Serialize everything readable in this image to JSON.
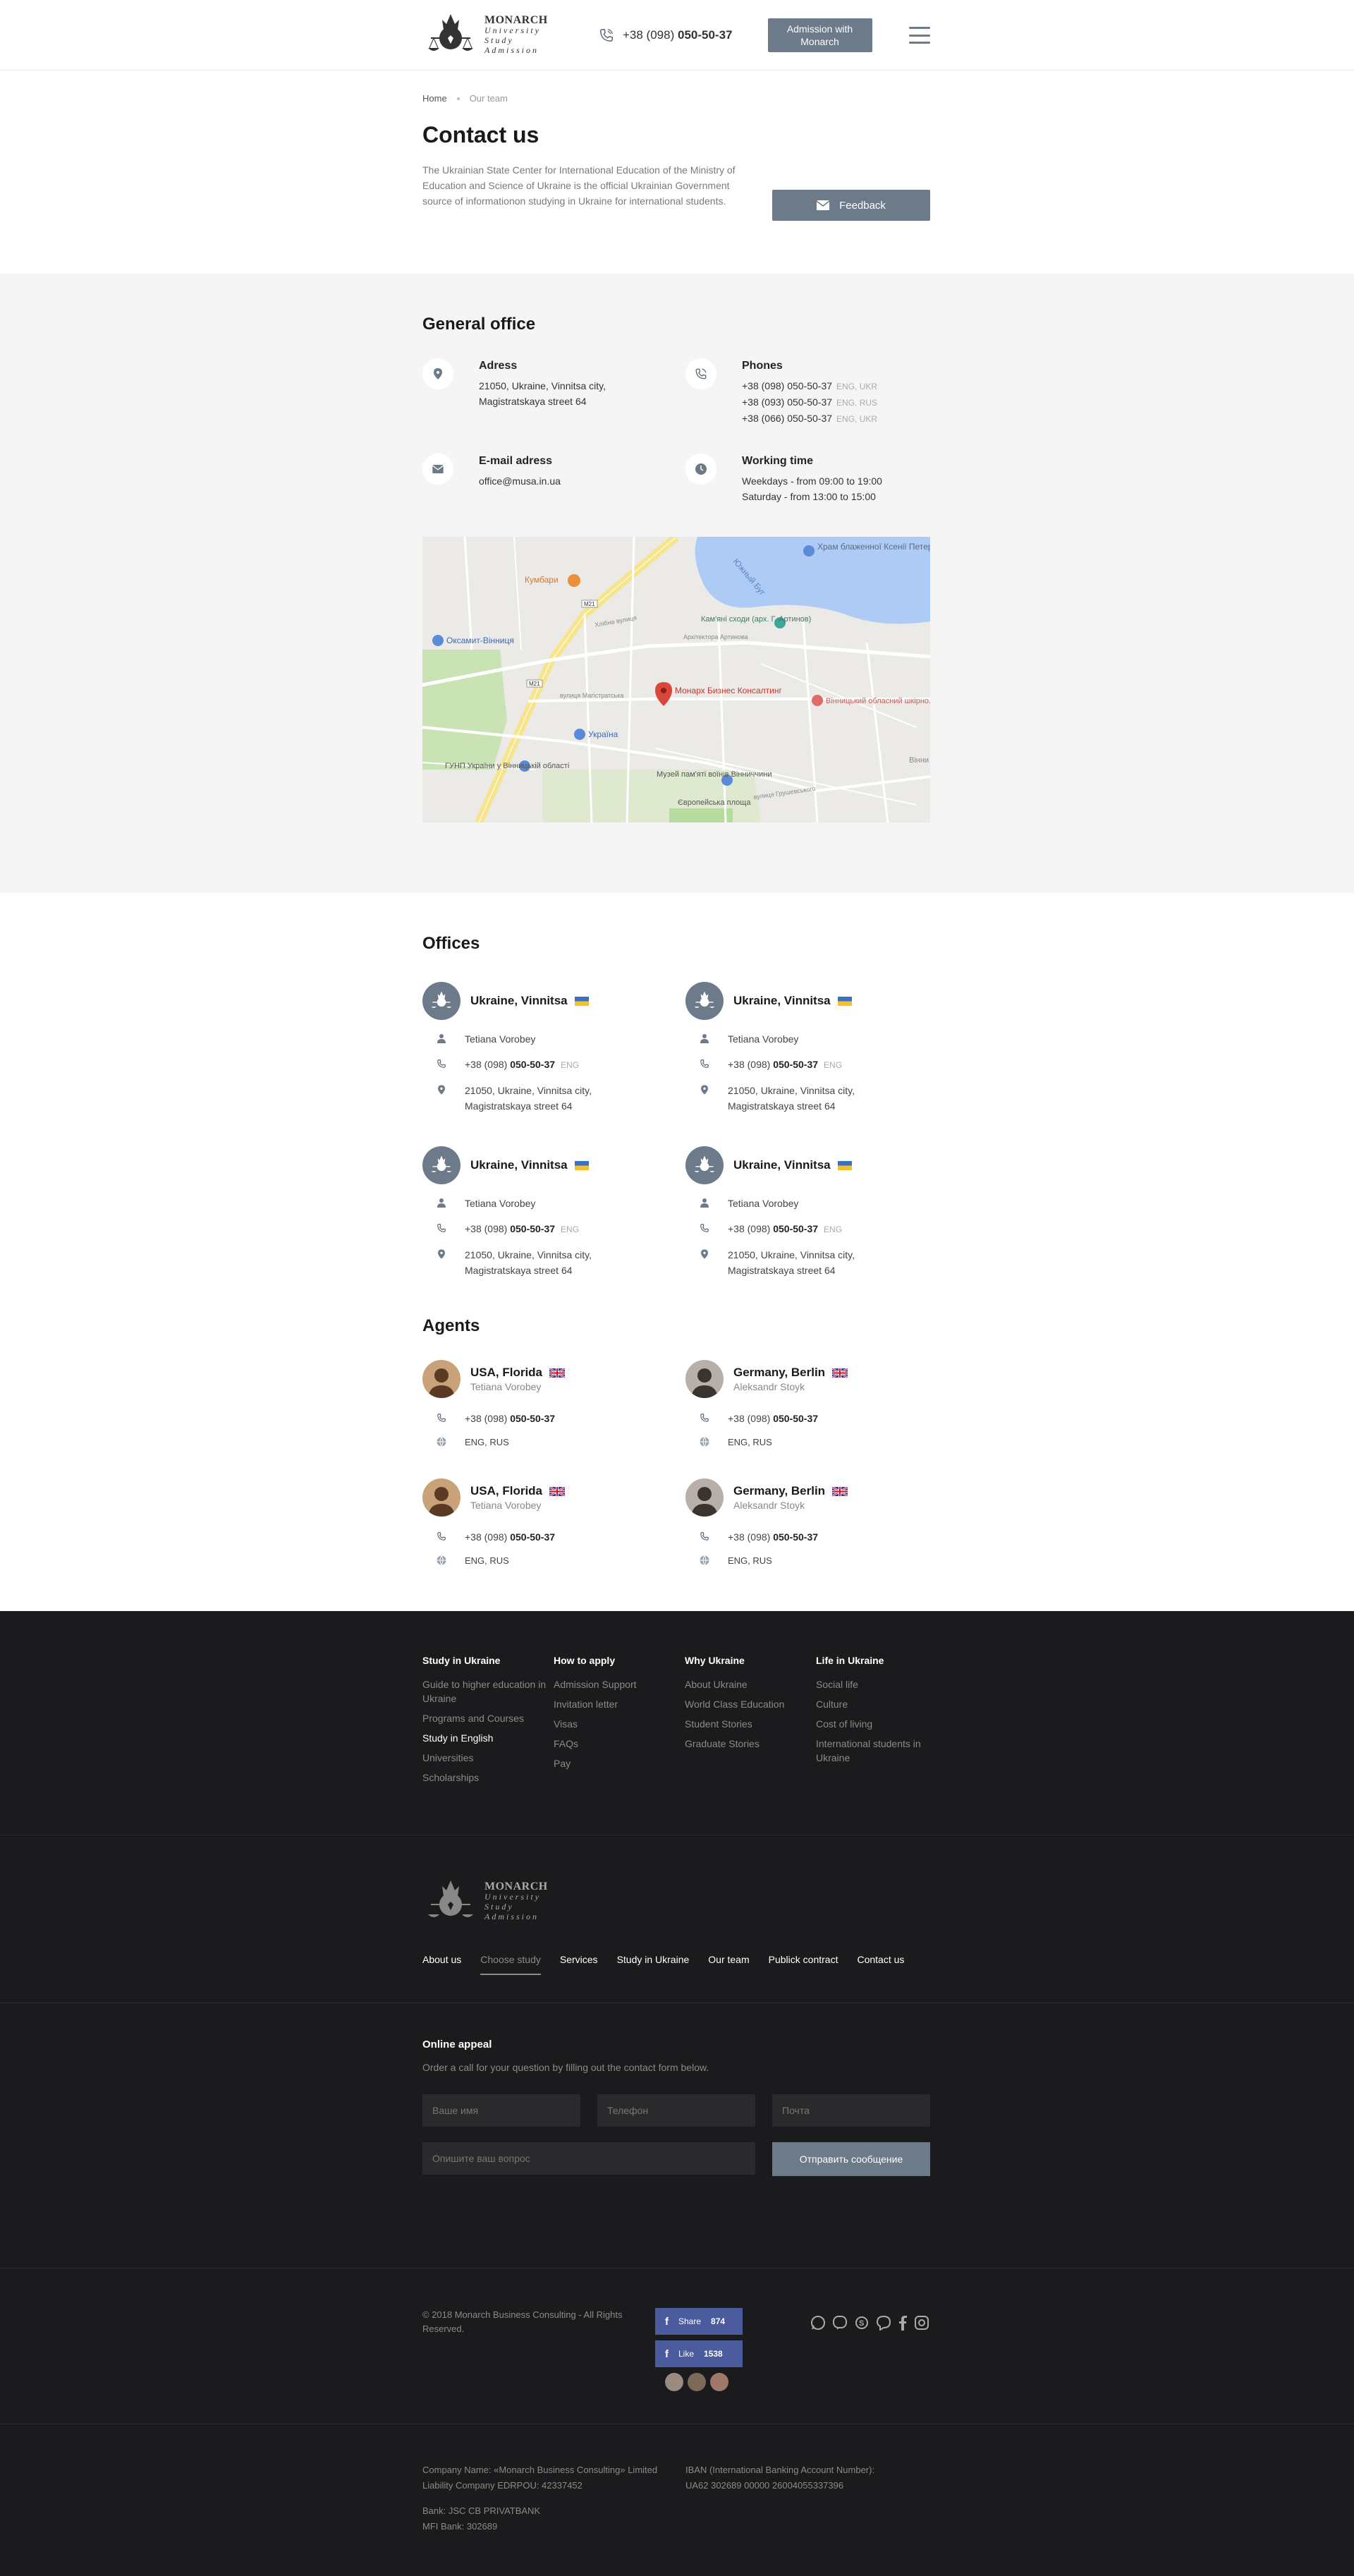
{
  "header": {
    "logo": {
      "title": "MONARCH",
      "l1": "University",
      "l2": "Study",
      "l3": "Admission"
    },
    "phone_prefix": "+38 (098)",
    "phone_main": "050-50-37",
    "admission_button": "Admission with Monarch"
  },
  "intro": {
    "breadcrumbs": [
      "Home",
      "Our team"
    ],
    "title": "Contact us",
    "description": "The Ukrainian State Center for International Education of the Ministry of Education and Science of Ukraine is the official Ukrainian Government source of informationon studying in Ukraine for international students.",
    "feedback_button": "Feedback"
  },
  "general": {
    "title": "General office",
    "address": {
      "label": "Adress",
      "lines": [
        "21050, Ukraine, Vinnitsa city,",
        "Magistratskaya street 64"
      ]
    },
    "phones": {
      "label": "Phones",
      "items": [
        {
          "num": "+38 (098) 050-50-37",
          "lang": "ENG, UKR"
        },
        {
          "num": "+38 (093) 050-50-37",
          "lang": "ENG, RUS"
        },
        {
          "num": "+38 (066) 050-50-37",
          "lang": "ENG, UKR"
        }
      ]
    },
    "email": {
      "label": "E-mail adress",
      "value": "office@musa.in.ua"
    },
    "working": {
      "label": "Working time",
      "lines": [
        "Weekdays - from 09:00 to 19:00",
        "Saturday - from 13:00 to 15:00"
      ]
    }
  },
  "map": {
    "labels": {
      "church": "Храм блаженної Ксенії Петербурзької",
      "kumbari": "Кумбари",
      "river": "Южный Буг",
      "stairs": "Кам'яні сходи (арх. Г. Артинов)",
      "oksamyt": "Оксамит-Вінниця",
      "marker": "Монарх Бизнес Консалтинг",
      "hospital": "Вінницький обласний шкірно...",
      "ukraine": "Україна",
      "gunp": "ГУНП України у Вінницькій області",
      "museum": "Музей пам'яті воїнів Вінниччини",
      "square": "Європейська площа",
      "vinn": "Вінни",
      "road1": "М21",
      "road2": "М21",
      "street1": "Хлібна вулиця",
      "street2": "Архітектора Артинова",
      "street3": "вулиця Магістратська",
      "street4": "вулиця Грушевського"
    }
  },
  "offices": {
    "title": "Offices",
    "items": [
      {
        "city": "Ukraine, Vinnitsa",
        "person": "Tetiana Vorobey",
        "phone_prefix": "+38 (098)",
        "phone_main": "050-50-37",
        "lang": "ENG",
        "addr1": "21050, Ukraine, Vinnitsa city,",
        "addr2": "Magistratskaya street 64"
      },
      {
        "city": "Ukraine, Vinnitsa",
        "person": "Tetiana Vorobey",
        "phone_prefix": "+38 (098)",
        "phone_main": "050-50-37",
        "lang": "ENG",
        "addr1": "21050, Ukraine, Vinnitsa city,",
        "addr2": "Magistratskaya street 64"
      },
      {
        "city": "Ukraine, Vinnitsa",
        "person": "Tetiana Vorobey",
        "phone_prefix": "+38 (098)",
        "phone_main": "050-50-37",
        "lang": "ENG",
        "addr1": "21050, Ukraine, Vinnitsa city,",
        "addr2": "Magistratskaya street 64"
      },
      {
        "city": "Ukraine, Vinnitsa",
        "person": "Tetiana Vorobey",
        "phone_prefix": "+38 (098)",
        "phone_main": "050-50-37",
        "lang": "ENG",
        "addr1": "21050, Ukraine, Vinnitsa city,",
        "addr2": "Magistratskaya street 64"
      }
    ]
  },
  "agents": {
    "title": "Agents",
    "items": [
      {
        "city": "USA, Florida",
        "name": "Tetiana Vorobey",
        "phone_prefix": "+38 (098)",
        "phone_main": "050-50-37",
        "langs": "ENG, RUS"
      },
      {
        "city": "Germany, Berlin",
        "name": "Aleksandr Stoyk",
        "phone_prefix": "+38 (098)",
        "phone_main": "050-50-37",
        "langs": "ENG, RUS"
      },
      {
        "city": "USA, Florida",
        "name": "Tetiana Vorobey",
        "phone_prefix": "+38 (098)",
        "phone_main": "050-50-37",
        "langs": "ENG, RUS"
      },
      {
        "city": "Germany, Berlin",
        "name": "Aleksandr Stoyk",
        "phone_prefix": "+38 (098)",
        "phone_main": "050-50-37",
        "langs": "ENG, RUS"
      }
    ]
  },
  "footer": {
    "columns": [
      {
        "title": "Study in Ukraine",
        "links": [
          "Guide to higher education in Ukraine",
          "Programs and Courses",
          "Study in English",
          "Universities",
          "Scholarships"
        ]
      },
      {
        "title": "How to apply",
        "links": [
          "Admission Support",
          "Invitation letter",
          "Visas",
          "FAQs",
          "Pay"
        ]
      },
      {
        "title": "Why Ukraine",
        "links": [
          "About Ukraine",
          "World Class Education",
          "Student Stories",
          "Graduate Stories"
        ]
      },
      {
        "title": "Life in Ukraine",
        "links": [
          "Social life",
          "Culture",
          "Cost of living",
          "International students in Ukraine"
        ]
      }
    ],
    "menu": [
      "About us",
      "Choose study",
      "Services",
      "Study in Ukraine",
      "Our team",
      "Publick contract",
      "Contact us"
    ],
    "appeal": {
      "title": "Online appeal",
      "text": "Order a call for your question by filling out the contact form below.",
      "name_ph": "Ваше имя",
      "phone_ph": "Телефон",
      "mail_ph": "Почта",
      "question_ph": "Опишите ваш вопрос",
      "submit": "Отправить сообщение"
    },
    "copyright": "© 2018 Monarch Business Consulting - All Rights Reserved.",
    "share": {
      "label": "Share",
      "count": "874"
    },
    "like": {
      "label": "Like",
      "count": "1538"
    },
    "legal": {
      "company": "Company Name: «Monarch Business Consulting» Limited Liability Company EDRPOU: 42337452",
      "bank": "Bank: JSC CB PRIVATBANK",
      "mfi": "MFI Bank: 302689",
      "iban_label": "IBAN (International Banking Account Number):",
      "iban": "UA62 302689 00000 26004055337396"
    }
  },
  "colors": {
    "accent": "#6c7a89",
    "footer_bg": "#1b1b1d",
    "facebook": "#4a5c9e"
  }
}
